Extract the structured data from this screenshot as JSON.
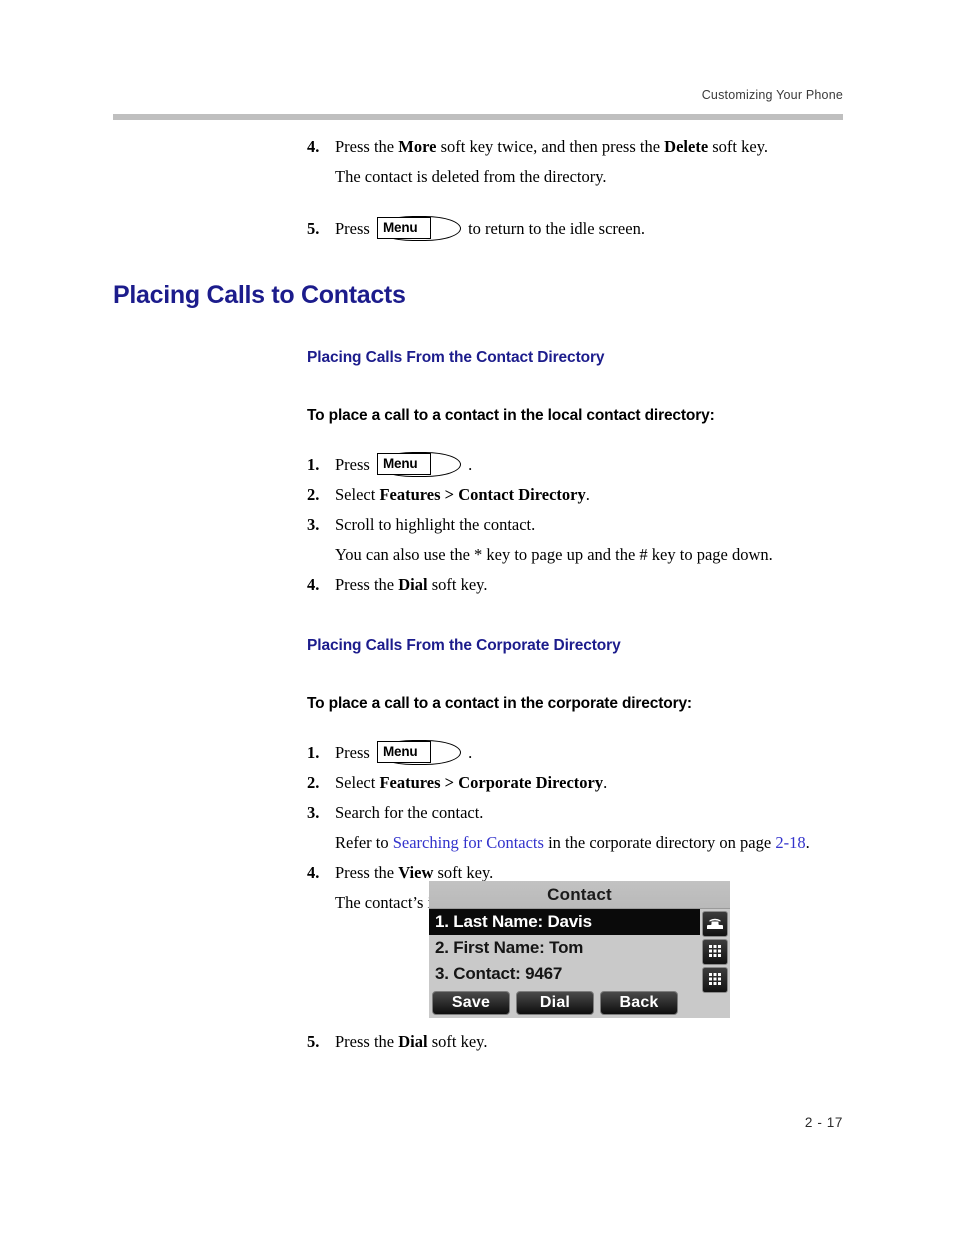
{
  "header": {
    "running_head": "Customizing Your Phone"
  },
  "footer": {
    "page_number": "2 - 17"
  },
  "colors": {
    "heading_blue": "#1c1c8c",
    "link_blue": "#3333cc",
    "rule_gray": "#bfbfbf",
    "lcd_background": "#c9c9c9",
    "lcd_selected": "#0a0a0a"
  },
  "top_steps": [
    {
      "number": "4.",
      "text_before": "Press the ",
      "bold1": "More",
      "text_mid": " soft key twice, and then press the ",
      "bold2": "Delete",
      "text_after": " soft key.",
      "continuation": "The contact is deleted from the directory."
    },
    {
      "number": "5.",
      "text_before": "Press ",
      "key_label": "Menu",
      "text_after": " to return to the idle screen."
    }
  ],
  "section": {
    "title": "Placing Calls to Contacts"
  },
  "subsection_local": {
    "title": "Placing Calls From the Contact Directory",
    "lead_in": "To place a call to a contact in the local contact directory:",
    "steps": [
      {
        "number": "1.",
        "text_before": "Press ",
        "key_label": "Menu",
        "text_after": " ."
      },
      {
        "number": "2.",
        "text_before": "Select ",
        "bold1": "Features > Contact Directory",
        "text_after": "."
      },
      {
        "number": "3.",
        "text_before": "Scroll to highlight the contact.",
        "continuation": "You can also use the * key to page up and the # key to page down."
      },
      {
        "number": "4.",
        "text_before": "Press the ",
        "bold1": "Dial",
        "text_after": " soft key."
      }
    ]
  },
  "subsection_corporate": {
    "title": "Placing Calls From the Corporate Directory",
    "lead_in": "To place a call to a contact in the corporate directory:",
    "steps": [
      {
        "number": "1.",
        "text_before": "Press ",
        "key_label": "Menu",
        "text_after": " ."
      },
      {
        "number": "2.",
        "text_before": "Select ",
        "bold1": "Features > Corporate Directory",
        "text_after": "."
      },
      {
        "number": "3.",
        "text_before": "Search for the contact.",
        "xref_prefix": "Refer to ",
        "xref_link": "Searching for Contacts",
        "xref_mid": " in the corporate directory on page ",
        "xref_page": "2-18",
        "xref_suffix": "."
      },
      {
        "number": "4.",
        "text_before": "Press the ",
        "bold1": "View",
        "text_after": " soft key.",
        "continuation": "The contact’s information appears on the screen."
      },
      {
        "number": "5.",
        "text_before": "Press the ",
        "bold1": "Dial",
        "text_after": " soft key."
      }
    ]
  },
  "phone_screen": {
    "title": "Contact",
    "rows": [
      {
        "label": "1. Last Name: Davis",
        "selected": true
      },
      {
        "label": "2. First Name: Tom",
        "selected": false
      },
      {
        "label": "3. Contact: 9467",
        "selected": false
      }
    ],
    "rail_icons": [
      "handset-icon",
      "keypad-icon",
      "keypad-icon"
    ],
    "soft_keys": [
      "Save",
      "Dial",
      "Back"
    ]
  }
}
